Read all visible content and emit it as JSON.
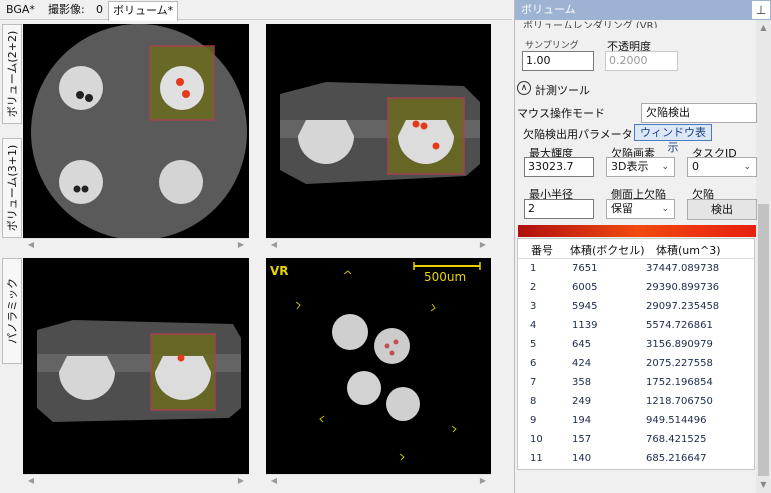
{
  "tabs": [
    "BGA*",
    "撮影像:",
    "0",
    "ボリューム*"
  ],
  "left_tabs": [
    "ボリューム(2+2)",
    "ボリューム(3+1)",
    "パノラミック"
  ],
  "vr": {
    "label": "VR",
    "scale_label": "500um"
  },
  "panel": {
    "title": "ボリューム",
    "pin_icon": "pin",
    "section_cut": "ボリュームレンダリング (VR)",
    "sampling_label": "サンプリング",
    "sampling_value": "1.00",
    "opacity_label": "不透明度",
    "opacity_value": "0.2000",
    "measure_tool_label": "計測ツール",
    "mouse_mode_label": "マウス操作モード",
    "mouse_mode_value": "欠陥検出",
    "defect_params_label": "欠陥検出用パラメータ",
    "window_button": "ウィンドウ表示",
    "max_brightness_label": "最大輝度",
    "max_brightness_value": "33023.7",
    "defect_image_label": "欠陥画素",
    "defect_image_value": "3D表示",
    "task_id_label": "タスクID",
    "task_id_value": "0",
    "min_radius_label": "最小半径",
    "min_radius_value": "2",
    "side_defect_label": "側面上欠陥",
    "side_defect_value": "保留",
    "defect_label": "欠陥",
    "detect_button": "検出"
  },
  "table": {
    "columns": [
      "番号",
      "体積(ボクセル)",
      "体積(um^3)"
    ],
    "rows": [
      [
        "1",
        "7651",
        "37447.089738"
      ],
      [
        "2",
        "6005",
        "29390.899736"
      ],
      [
        "3",
        "5945",
        "29097.235458"
      ],
      [
        "4",
        "1139",
        "5574.726861"
      ],
      [
        "5",
        "645",
        "3156.890979"
      ],
      [
        "6",
        "424",
        "2075.227558"
      ],
      [
        "7",
        "358",
        "1752.196854"
      ],
      [
        "8",
        "249",
        "1218.706750"
      ],
      [
        "9",
        "194",
        "949.514496"
      ],
      [
        "10",
        "157",
        "768.421525"
      ],
      [
        "11",
        "140",
        "685.216647"
      ]
    ]
  },
  "colors": {
    "panel_title_bg": "#9db3d4",
    "highlight_box": "#d6d600",
    "defect": "#e23a1a"
  }
}
